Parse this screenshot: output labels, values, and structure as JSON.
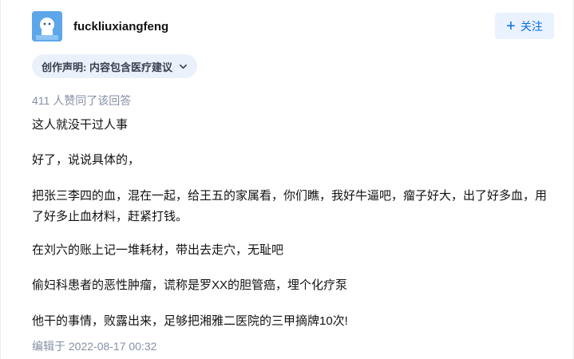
{
  "author": {
    "name": "fuckliuxiangfeng",
    "avatar_icon": "avatar-icon",
    "follow_label": "关注"
  },
  "declaration": {
    "label": "创作声明: 内容包含医疗建议"
  },
  "votes_text": "411 人赞同了该回答",
  "paragraphs": [
    "这人就没干过人事",
    "好了，说说具体的，",
    "把张三李四的血，混在一起，给王五的家属看，你们瞧，我好牛逼吧，瘤子好大，出了好多血，用了好多止血材料，赶紧打钱。",
    "在刘六的账上记一堆耗材，带出去走穴，无耻吧",
    "偷妇科患者的恶性肿瘤，谎称是罗XX的胆管癌，埋个化疗泵",
    "他干的事情，败露出来，足够把湘雅二医院的三甲摘牌10次!"
  ],
  "edited_text": "编辑于 2022-08-17 00:32",
  "colors": {
    "accent": "#056de8",
    "meta": "#8590a6",
    "text": "#121212"
  }
}
